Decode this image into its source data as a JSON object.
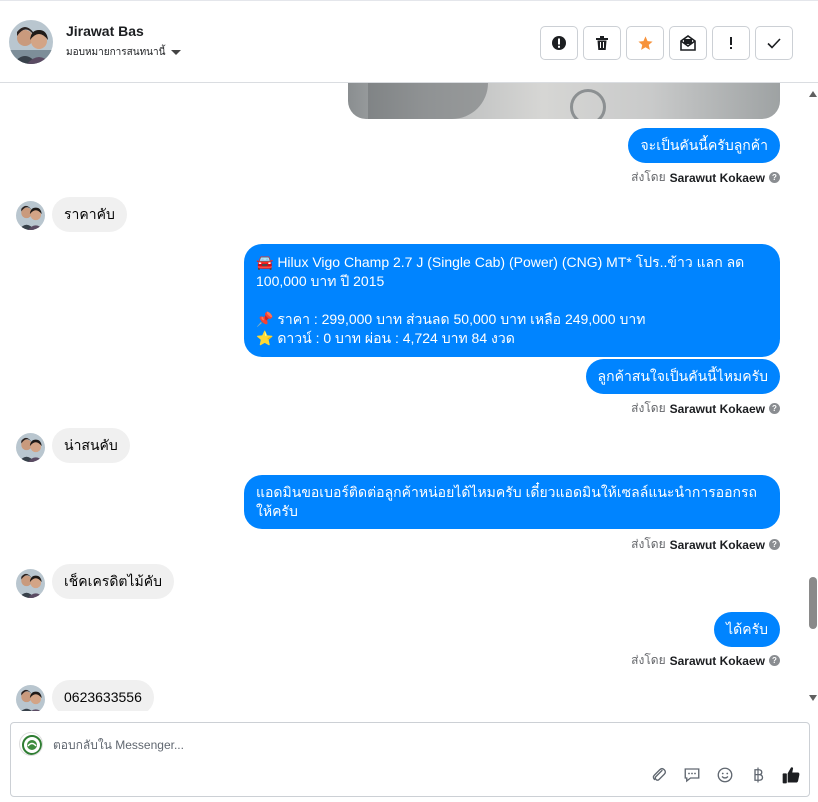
{
  "header": {
    "contact_name": "Jirawat Bas",
    "assign_label": "มอบหมายการสนทนานี้",
    "actions": [
      "spam-icon",
      "trash-icon",
      "star-icon",
      "unread-icon",
      "important-icon",
      "done-icon"
    ]
  },
  "messages": [
    {
      "id": "m1",
      "dir": "out",
      "text": "จะเป็นคันนี้ครับลูกค้า",
      "sent_by_prefix": "ส่งโดย",
      "sent_by": "Sarawut Kokaew"
    },
    {
      "id": "m2",
      "dir": "in",
      "text": "ราคาคับ"
    },
    {
      "id": "m3",
      "dir": "out",
      "lines": [
        "🚘 Hilux Vigo Champ 2.7 J (Single Cab) (Power) (CNG) MT* โปร..ข้าว แลก ลด 100,000 บาท ปี 2015",
        "",
        "📌 ราคา : 299,000 บาท ส่วนลด 50,000 บาท เหลือ 249,000 บาท",
        "⭐ ดาวน์ : 0 บาท ผ่อน : 4,724 บาท 84 งวด"
      ]
    },
    {
      "id": "m4",
      "dir": "out",
      "text": "ลูกค้าสนใจเป็นคันนี้ไหมครับ",
      "sent_by_prefix": "ส่งโดย",
      "sent_by": "Sarawut Kokaew"
    },
    {
      "id": "m5",
      "dir": "in",
      "text": "น่าสนคับ"
    },
    {
      "id": "m6",
      "dir": "out",
      "text": "แอดมินขอเบอร์ติดต่อลูกค้าหน่อยได้ไหมครับ เดี๋ยวแอดมินให้เซลล์แนะนำการออกรถให้ครับ",
      "sent_by_prefix": "ส่งโดย",
      "sent_by": "Sarawut Kokaew"
    },
    {
      "id": "m7",
      "dir": "in",
      "text": "เช็คเครดิตไม้คับ"
    },
    {
      "id": "m8",
      "dir": "out",
      "text": "ได้ครับ",
      "sent_by_prefix": "ส่งโดย",
      "sent_by": "Sarawut Kokaew"
    },
    {
      "id": "m9",
      "dir": "in",
      "text": "0623633556"
    }
  ],
  "composer": {
    "placeholder": "ตอบกลับใน Messenger...",
    "tools": [
      "attachment-icon",
      "saved-reply-icon",
      "emoji-icon",
      "baht-payment-icon",
      "like-icon"
    ]
  },
  "colors": {
    "outgoing_bubble": "#0084ff",
    "incoming_bubble": "#f0f0f0",
    "star": "#f7923a"
  }
}
